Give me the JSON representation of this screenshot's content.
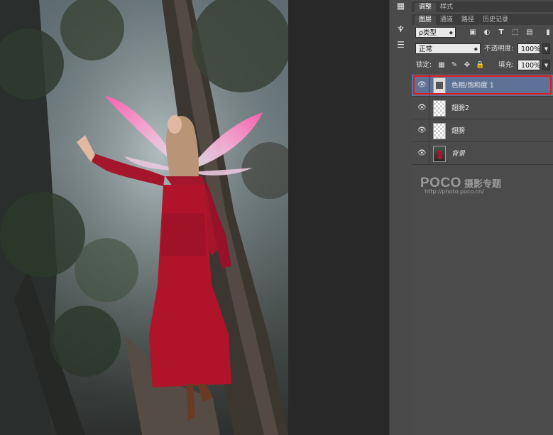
{
  "panel_tabs_top": [
    {
      "label": "调整",
      "active": true
    },
    {
      "label": "样式",
      "active": false
    }
  ],
  "panel_tabs_layers": [
    {
      "label": "图层",
      "active": true
    },
    {
      "label": "通道",
      "active": false
    },
    {
      "label": "路径",
      "active": false
    },
    {
      "label": "历史记录",
      "active": false
    }
  ],
  "filter": {
    "kind_label": "ρ类型"
  },
  "blend": {
    "mode": "正常",
    "opacity_label": "不透明度:",
    "opacity": "100%"
  },
  "lock": {
    "label": "锁定:",
    "fill_label": "填充:",
    "fill": "100%"
  },
  "layers": [
    {
      "name": "色相/饱和度 1",
      "selected": true,
      "italic": false,
      "thumb": "adjustment-icon"
    },
    {
      "name": "翅膀2",
      "selected": false,
      "italic": false,
      "thumb": "transparent"
    },
    {
      "name": "翅膀",
      "selected": false,
      "italic": false,
      "thumb": "transparent"
    },
    {
      "name": "背景",
      "selected": false,
      "italic": true,
      "thumb": "photo"
    }
  ],
  "watermark": {
    "word": "POCO",
    "cn": "摄影专题",
    "url": "http://photo.poco.cn/"
  },
  "colors": {
    "selection": "#5e7297",
    "highlight": "#e11a1a",
    "dress": "#b0142a",
    "wing": "#e0459a"
  }
}
